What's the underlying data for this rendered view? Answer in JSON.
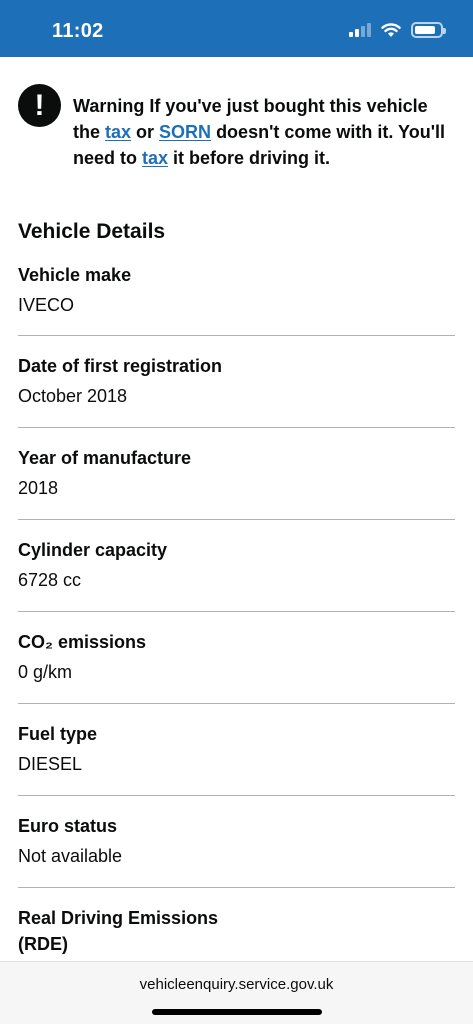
{
  "status_bar": {
    "time": "11:02",
    "battery_level": 0.85
  },
  "warning": {
    "icon": "exclamation-icon",
    "prefix": "Warning If you've just bought this vehicle the ",
    "link1": "tax",
    "mid1": " or ",
    "link2": "SORN",
    "mid2": " doesn't come with it. You'll need to ",
    "link3": "tax",
    "suffix": " it before driving it."
  },
  "section_title": "Vehicle Details",
  "details": [
    {
      "key": "Vehicle make",
      "value": "IVECO"
    },
    {
      "key": "Date of first registration",
      "value": "October 2018"
    },
    {
      "key": "Year of manufacture",
      "value": "2018"
    },
    {
      "key": "Cylinder capacity",
      "value": "6728 cc"
    },
    {
      "key": "CO₂ emissions",
      "value": "0 g/km"
    },
    {
      "key": "Fuel type",
      "value": "DIESEL"
    },
    {
      "key": "Euro status",
      "value": "Not available"
    },
    {
      "key": "Real Driving Emissions (RDE)",
      "value": ""
    }
  ],
  "bottom_bar": {
    "url": "vehicleenquiry.service.gov.uk"
  },
  "colors": {
    "header_blue": "#1d70b8",
    "link_blue": "#1d70b8",
    "text": "#0b0c0c",
    "divider": "#b1b4b6"
  }
}
